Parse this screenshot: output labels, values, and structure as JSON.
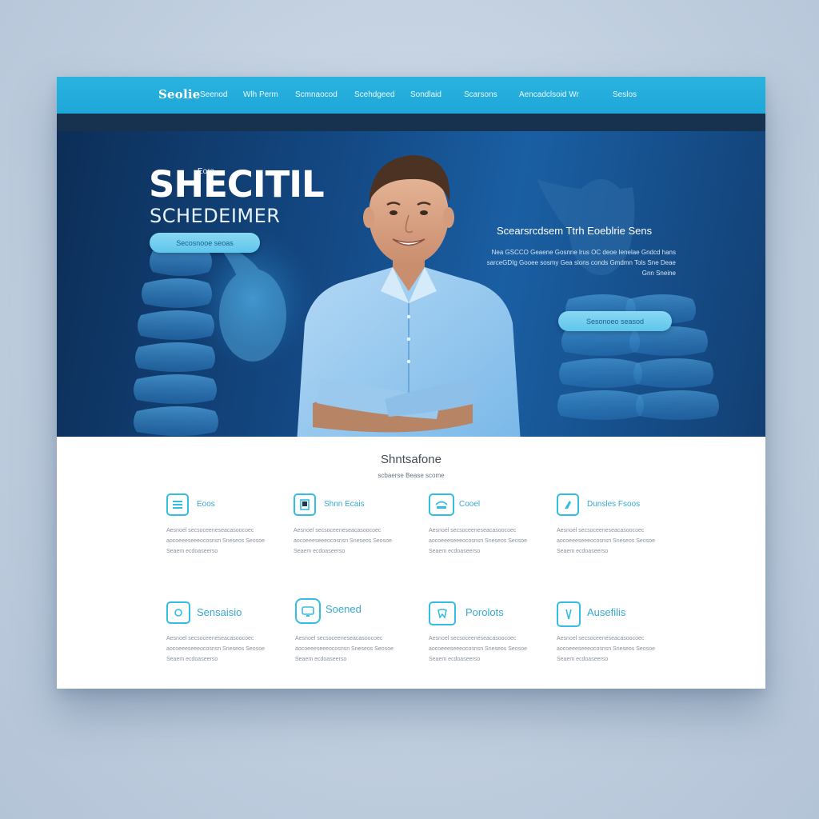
{
  "nav": {
    "logo": "Seolie",
    "links": [
      "Seenod",
      "Wlh Perm",
      "Scmnaocod",
      "Scehdgeed",
      "Sondlaid",
      "Scarsons",
      "Aencadclsoid Wr",
      "Seslos"
    ]
  },
  "hero": {
    "title_small": "Eoro",
    "title": "SHECITIL",
    "subtitle": "SCHEDEIMER",
    "left_button": "Secosnooe seoas",
    "side_title": "Scearsrcdsem Ttrh Eoeblrie Sens",
    "side_text": "Nea GSCCO Geaene Gosnne lrus OC deoe Ienelae Gndcd hans sarceGDIg Gooee sosmy Gea slons conds Gmdmn Tols Sne Deae Gnn Sneine",
    "right_button": "Sesonoeo seasod"
  },
  "services": {
    "title": "Shntsafone",
    "subtitle": "scbaerse Bease scome",
    "cards": [
      {
        "title": "Eoos",
        "text": "Aesnoel secsoceeneseacasoocoec aocoeeeseeeocosnsn Sneseos Seosoe Seaem ecdoaseerso"
      },
      {
        "title": "Shnn Ecais",
        "text": "Aesnoel secsoceeneseacasoocoec aocoeeeseeeocosnsn Sneseos Seosoe Seaem ecdoaseerso"
      },
      {
        "title": "Cooel",
        "text": "Aesnoel secsoceeneseacasoocoec aocoeeeseeeocosnsn Sneseos Seosoe Seaem ecdoaseerso"
      },
      {
        "title": "Dunsles Fsoos",
        "text": "Aesnoel secsoceeneseacasoocoec aocoeeeseeeocosnsn Sneseos Seosoe Seaem ecdoaseerso"
      },
      {
        "title": "Sensaisio",
        "text": "Aesnoel secsoceeneseacasoocoec aocoeeeseeeocosnsn Sneseos Seosoe Seaem ecdoaseerso"
      },
      {
        "title": "Soened",
        "text": "Aesnoel secsoceeneseacasoocoec aocoeeeseeeocosnsn Sneseos Seosoe Seaem ecdoaseerso"
      },
      {
        "title": "Porolots",
        "text": "Aesnoel secsoceeneseacasoocoec aocoeeeseeeocosnsn Sneseos Seosoe Seaem ecdoaseerso"
      },
      {
        "title": "Ausefilis",
        "text": "Aesnoel secsoceeneseacasoocoec aocoeeeseeeocosnsn Sneseos Seosoe Seaem ecdoaseerso"
      }
    ]
  },
  "colors": {
    "nav": "#1ea7d8",
    "hero_dark": "#0c2e57",
    "accent": "#33bde3",
    "button": "#5ec6ec",
    "background": "#c5d3e3"
  },
  "icons": [
    "list-icon",
    "document-icon",
    "tray-icon",
    "hand-icon",
    "monitor-icon",
    "screen-icon",
    "tooth-icon",
    "tool-icon"
  ]
}
